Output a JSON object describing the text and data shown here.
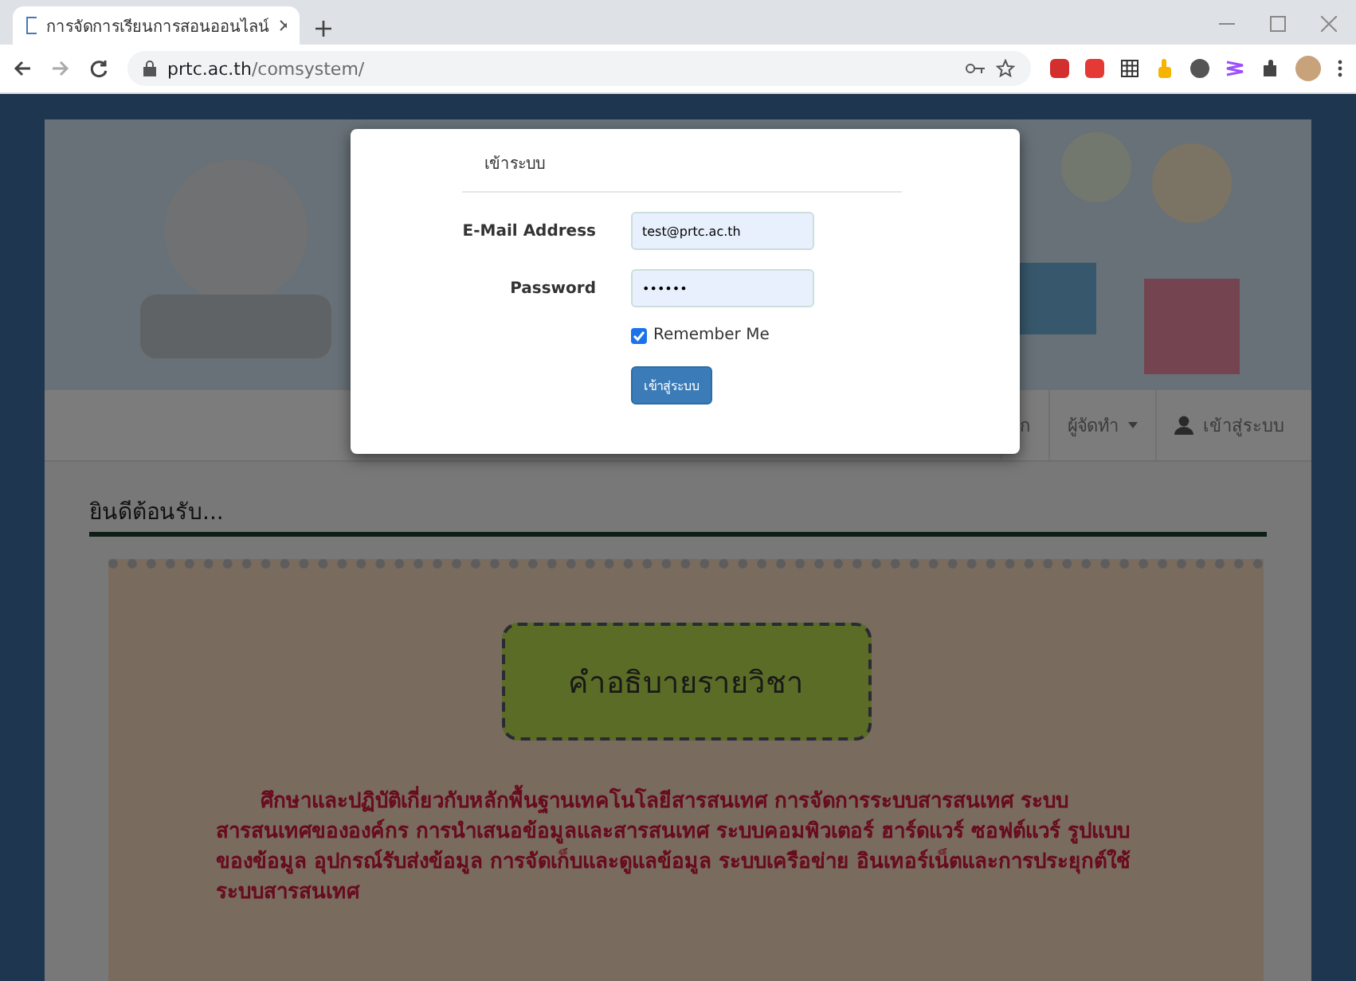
{
  "browser": {
    "tab_title": "การจัดการเรียนการสอนออนไลน์",
    "url_host": "prtc.ac.th",
    "url_path": "/comsystem/"
  },
  "navbar": {
    "items": [
      {
        "label": "ก",
        "kind": "link"
      },
      {
        "label": "ผู้จัดทำ",
        "kind": "dropdown"
      },
      {
        "label": "เข้าสู่ระบบ",
        "kind": "user"
      }
    ]
  },
  "welcome": "ยินดีต้อนรับ...",
  "poster": {
    "title": "คำอธิบายรายวิชา",
    "description": "ศึกษาและปฏิบัติเกี่ยวกับหลักพื้นฐานเทคโนโลยีสารสนเทศ การจัดการระบบสารสนเทศ ระบบสารสนเทศขององค์กร การนำเสนอข้อมูลและสารสนเทศ ระบบคอมพิวเตอร์ ฮาร์ดแวร์ ซอฟต์แวร์ รูปแบบของข้อมูล อุปกรณ์รับส่งข้อมูล การจัดเก็บและดูแลข้อมูล ระบบเครือข่าย อินเทอร์เน็ตและการประยุกต์ใช้ระบบสารสนเทศ"
  },
  "login_dialog": {
    "title": "เข้าระบบ",
    "fields": [
      {
        "label": "E-Mail Address",
        "value": "test@prtc.ac.th"
      },
      {
        "label": "Password",
        "value": "••••••"
      }
    ],
    "remember": {
      "label": "Remember Me",
      "checked": true
    },
    "submit": "เข้าสู่ระบบ"
  }
}
